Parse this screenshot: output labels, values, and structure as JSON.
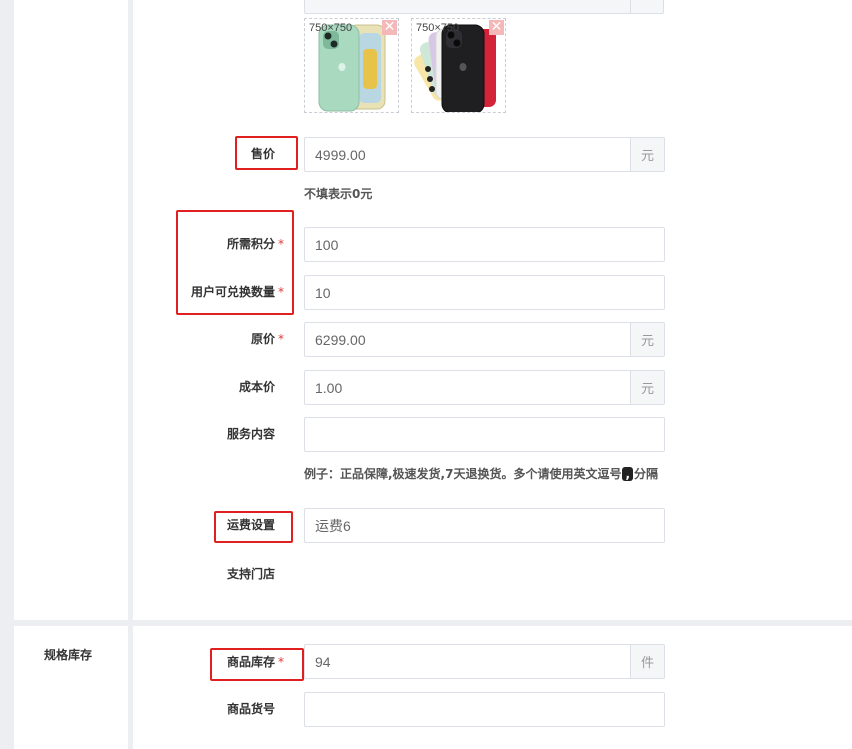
{
  "images": {
    "thumb_size_label_1": "750×750",
    "thumb_size_label_2": "750×750",
    "delete_symbol": "✕"
  },
  "form": {
    "sale_price": {
      "label": "售价",
      "value": "4999.00",
      "unit": "元",
      "hint": "不填表示0元"
    },
    "points_required": {
      "label": "所需积分",
      "required_mark": "*",
      "value": "100"
    },
    "exchange_quantity": {
      "label": "用户可兑换数量",
      "required_mark": "*",
      "value": "10"
    },
    "original_price": {
      "label": "原价",
      "required_mark": "*",
      "value": "6299.00",
      "unit": "元"
    },
    "cost_price": {
      "label": "成本价",
      "value": "1.00",
      "unit": "元"
    },
    "service_content": {
      "label": "服务内容",
      "value": "",
      "hint_before": "例子：正品保障,极速发货,7天退换货。多个请使用英文逗号",
      "hint_chip": ",",
      "hint_after": "分隔"
    },
    "shipping": {
      "label": "运费设置",
      "value": "运费6"
    },
    "support_store": {
      "label": "支持门店"
    }
  },
  "spec_section": {
    "title": "规格库存",
    "stock": {
      "label": "商品库存",
      "required_mark": "*",
      "value": "94",
      "unit": "件"
    },
    "sku_code": {
      "label": "商品货号",
      "value": ""
    }
  },
  "colors": {
    "highlight": "#e02020",
    "required": "#e4393c"
  }
}
